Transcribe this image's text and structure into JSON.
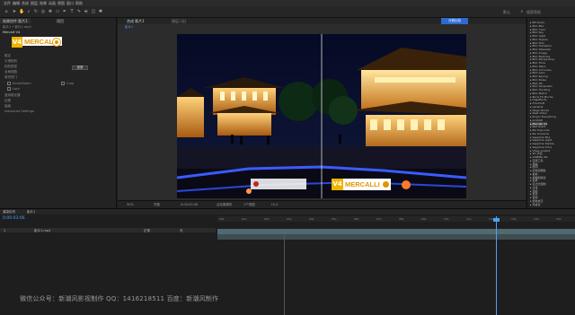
{
  "app": {
    "title": "Adobe After Effects"
  },
  "menubar": {
    "items": [
      "文件",
      "编辑",
      "合成",
      "图层",
      "效果",
      "动画",
      "视图",
      "窗口",
      "帮助"
    ]
  },
  "toolbar": {
    "workspace_label": "默认",
    "search_placeholder": "搜索帮助"
  },
  "left_panel": {
    "tabs": [
      "效果控件 影片1",
      "项目"
    ],
    "layer_label": "影片1 • 影片1.mp4",
    "effect_name": "Mercalli V4",
    "reset_label": "重置",
    "params": [
      "稳定",
      "平滑相机",
      "相机类型",
      "全局视图",
      "卷帘快门",
      "虚拟稳定器",
      "边框",
      "高级",
      "Advanced Settings"
    ],
    "options": [
      "SmartZoom",
      "Lock",
      "Crop"
    ]
  },
  "logo": {
    "badge": "V4",
    "text": "MERCALLI"
  },
  "comp_panel": {
    "tab_label": "合成 影片1",
    "tab2_label": "图层 (无)",
    "sub_label": "影片1",
    "blue_button": "分割比较",
    "bottom_controls": [
      "50%",
      "完整",
      "0:00:03:06",
      "活动摄像机",
      "1个视图",
      "+0.0"
    ]
  },
  "effects_panel": {
    "items": [
      "RE:Vision",
      "BCC Blur",
      "BCC Color",
      "BCC Key",
      "BCC Light",
      "BCC Stylize",
      "BCC Film",
      "BCC Transition",
      "BCC Obsolete",
      "BCC Image",
      "BCC Particles",
      "BCC Perspective",
      "BCC Time",
      "BCC Warp",
      "BCC Art Looks",
      "BCC Lens",
      "BCC Keying",
      "BCC Noise",
      "BCC 3D",
      "BCC Generator",
      "BCC Tracking",
      "BCC Match",
      "Boris FX Mocha",
      "Digieffects",
      "Frischluft",
      "Genarts",
      "Magic Bullet",
      "Neat Video",
      "Plugin Everything",
      "proDAD",
      "Mercalli V4",
      "Red Giant",
      "RG Trapcode",
      "RG Universe",
      "Sapphire Blur",
      "Sapphire Light",
      "Sapphire Stylize",
      "Sapphire Time",
      "Video Copilot",
      "3D 声道",
      "CINEMA 4D",
      "实用工具",
      "扭曲",
      "时间",
      "杂色和颗粒",
      "模拟",
      "模糊和锐化",
      "生成",
      "表达式控制",
      "过渡",
      "透视",
      "遮罩",
      "音频",
      "颜色校正",
      "风格化"
    ],
    "highlighted": "Mercalli V4"
  },
  "timeline": {
    "tabs": [
      "渲染队列",
      "影片1"
    ],
    "timecode": "0:00:03:06",
    "layer_name": "影片1.mp4",
    "layer_index": "1",
    "mode": "正常",
    "parent": "无",
    "ruler_ticks": [
      "00s",
      "01s",
      "02s",
      "03s",
      "04s",
      "05s",
      "06s",
      "07s",
      "08s",
      "09s",
      "10s",
      "11s",
      "12s",
      "13s",
      "14s",
      "15s"
    ]
  },
  "overlay_badge": {
    "badge": "V4",
    "text": "MERCALLI"
  },
  "watermark": "微信公众号：新潮风影视制作  QQ：1416218511  百度：新潮风制作",
  "colors": {
    "accent": "#2e6bd1",
    "timecode": "#4aa3ff",
    "logo_orange": "#f0b400"
  }
}
